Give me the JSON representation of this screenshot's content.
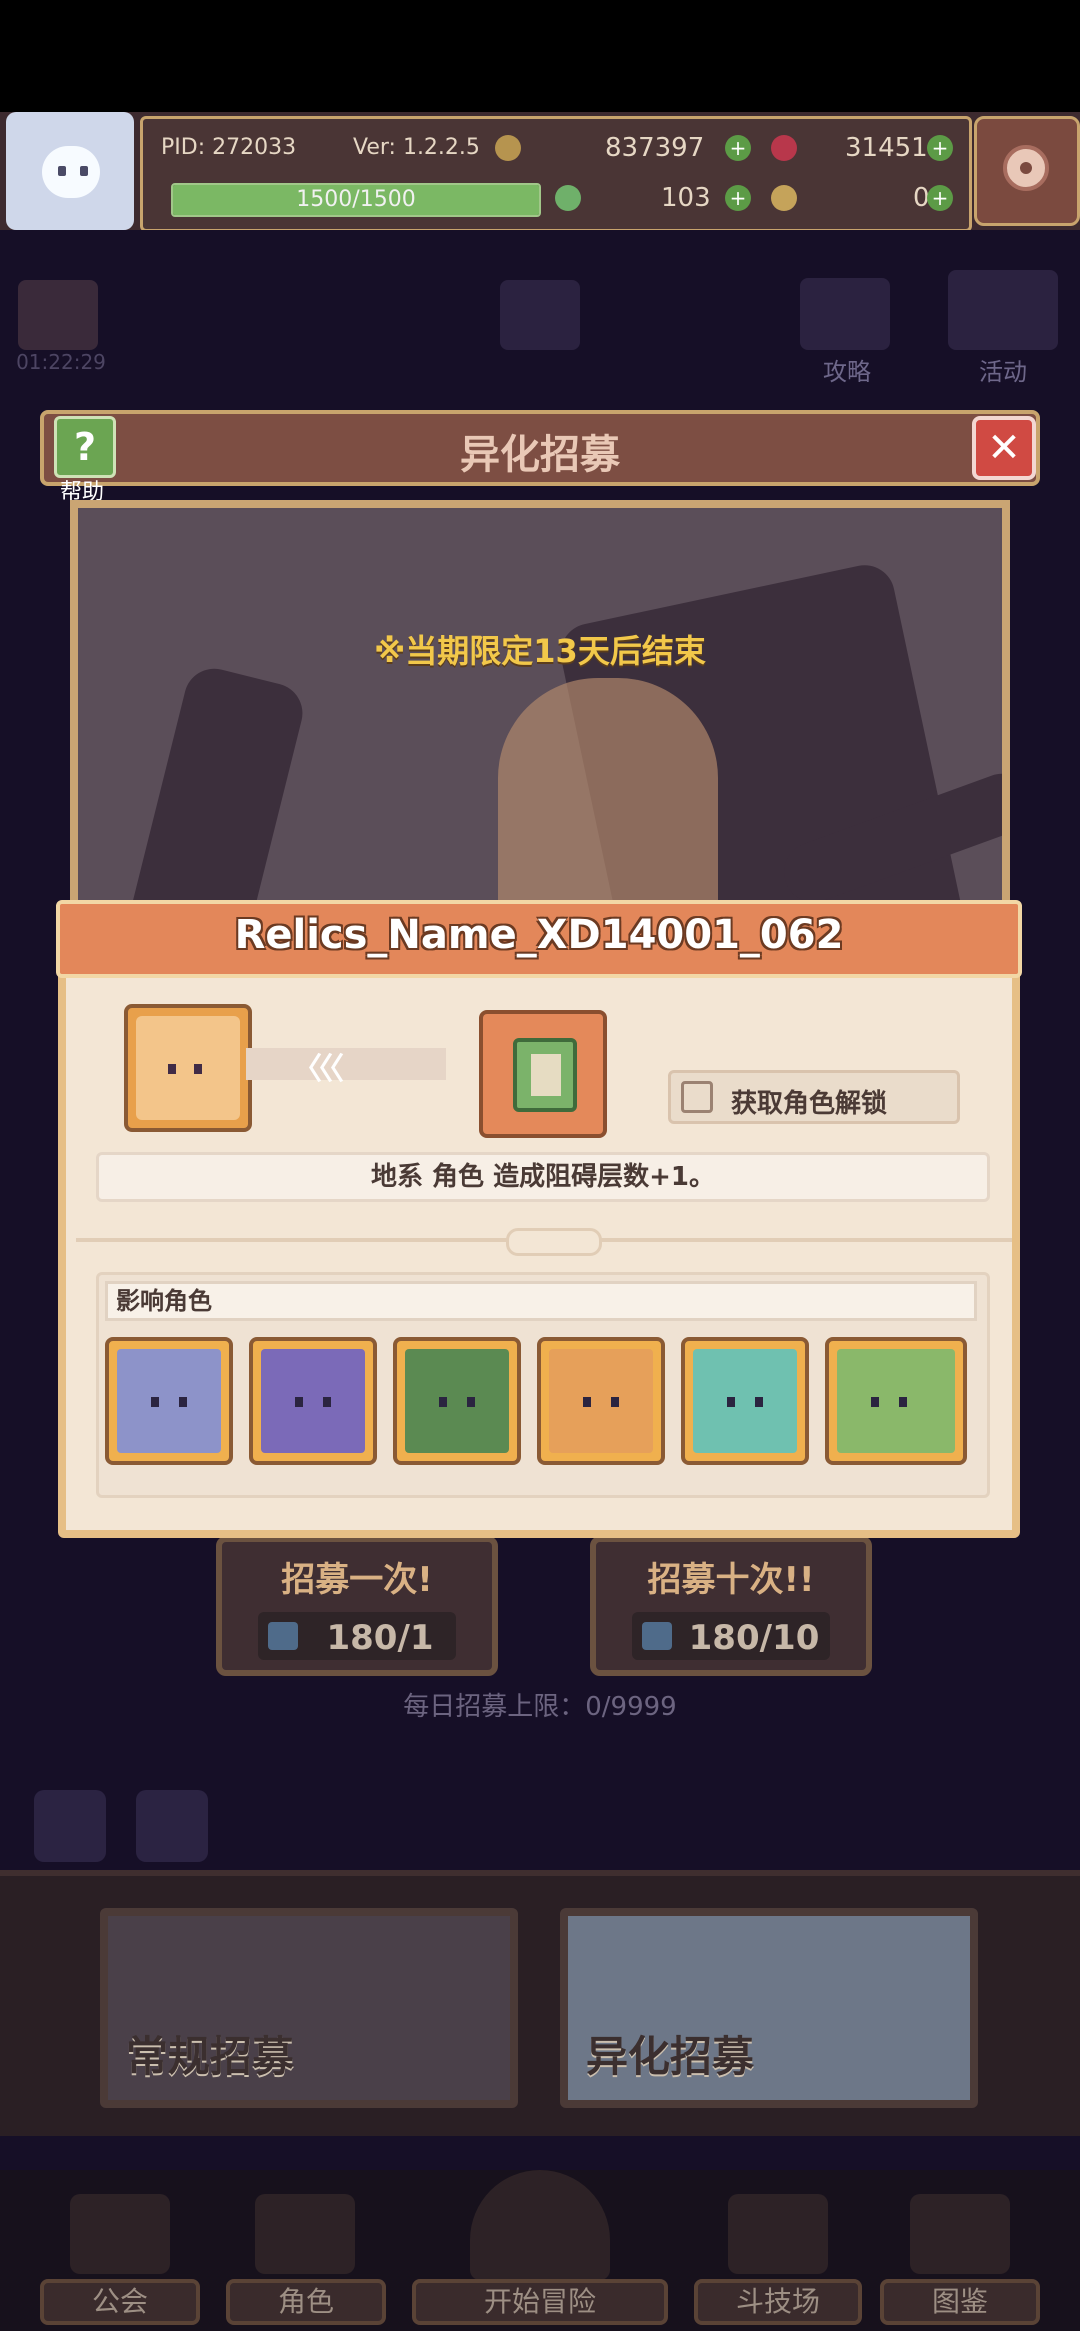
{
  "hud": {
    "pid": "PID: 272033",
    "version": "Ver: 1.2.2.5",
    "gold": "837397",
    "gems": "31451",
    "stamina": "1500/1500",
    "clover": "103",
    "keys": "0",
    "stamina_fraction": 1.0
  },
  "side": {
    "timer": "01:22:29",
    "guide": "攻略",
    "event": "活动"
  },
  "dialog": {
    "title": "异化招募",
    "help": "帮助",
    "notice": "※当期限定13天后结束"
  },
  "relic": {
    "name": "Relics_Name_XD14001_062",
    "unlock_label": "获取角色解锁",
    "effect": "地系 角色 造成阻碍层数+1。",
    "affected_label": "影响角色"
  },
  "recruit": {
    "once_label": "招募一次!",
    "once_cost": "180/1",
    "ten_label": "招募十次!!",
    "ten_cost": "180/10",
    "daily_limit": "每日招募上限：0/9999"
  },
  "tabs": {
    "normal": "常规招募",
    "alien": "异化招募"
  },
  "nav": {
    "guild": "公会",
    "role": "角色",
    "adventure": "开始冒险",
    "arena": "斗技场",
    "codex": "图鉴"
  },
  "colors": {
    "accent_orange": "#e3875a",
    "gold_text": "#f2c84a",
    "card_bg": "#f3e6d5"
  }
}
